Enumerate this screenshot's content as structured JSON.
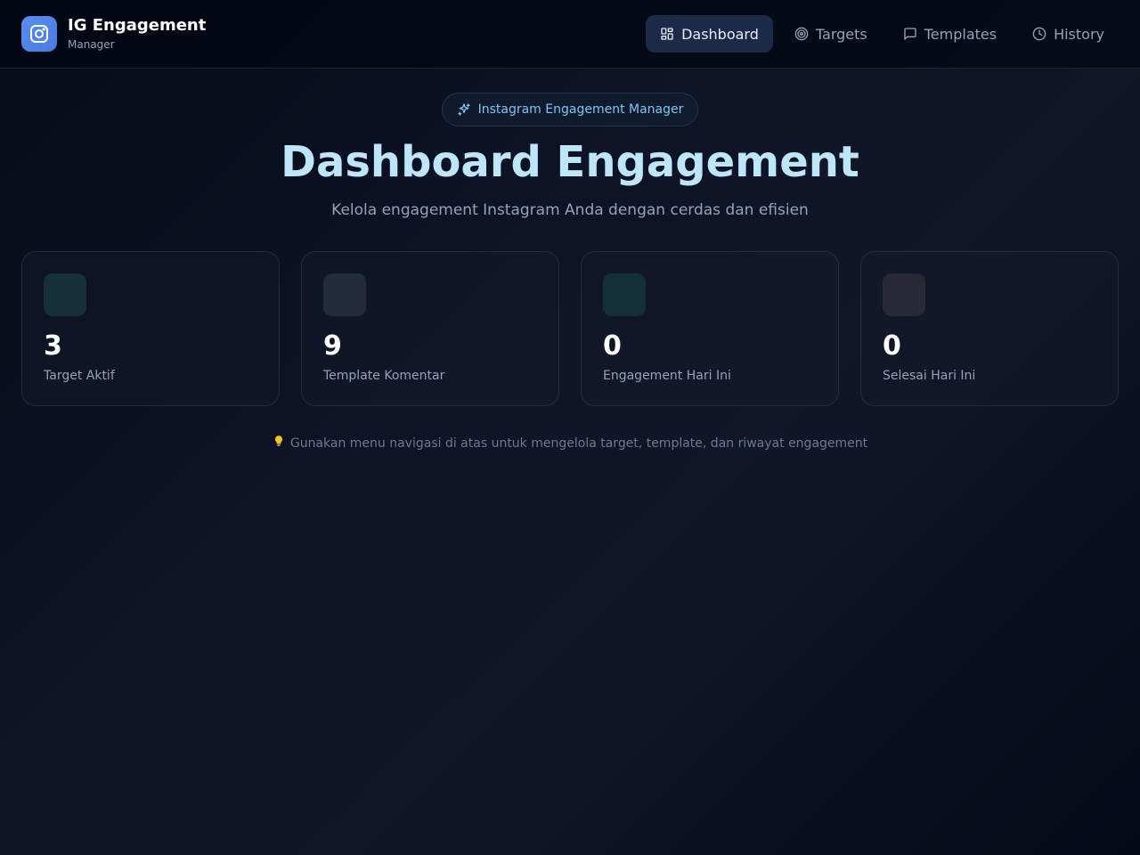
{
  "brand": {
    "title": "IG Engagement",
    "subtitle": "Manager",
    "icon": "instagram-icon",
    "accent": "#5b8def"
  },
  "nav": [
    {
      "label": "Dashboard",
      "icon": "dashboard-icon",
      "active": true
    },
    {
      "label": "Targets",
      "icon": "target-icon",
      "active": false
    },
    {
      "label": "Templates",
      "icon": "message-square-icon",
      "active": false
    },
    {
      "label": "History",
      "icon": "clock-icon",
      "active": false
    }
  ],
  "hero": {
    "pill_label": "Instagram Engagement Manager",
    "pill_icon": "sparkles-icon",
    "title": "Dashboard Engagement",
    "subtitle": "Kelola engagement Instagram Anda dengan cerdas dan efisien"
  },
  "stats": [
    {
      "value": "3",
      "label": "Target Aktif",
      "icon_color": "#15303a"
    },
    {
      "value": "9",
      "label": "Template Komentar",
      "icon_color": "#232c3b"
    },
    {
      "value": "0",
      "label": "Engagement Hari Ini",
      "icon_color": "#13303a"
    },
    {
      "value": "0",
      "label": "Selesai Hari Ini",
      "icon_color": "#272936"
    }
  ],
  "tip": {
    "icon": "lightbulb-icon",
    "text": "Gunakan menu navigasi di atas untuk mengelola target, template, dan riwayat engagement"
  }
}
